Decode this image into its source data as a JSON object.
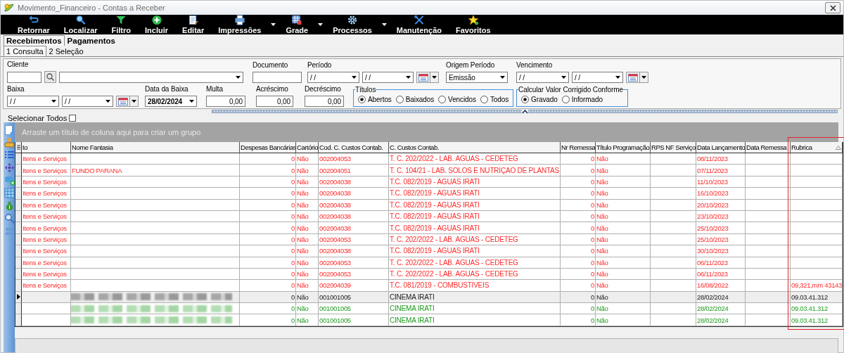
{
  "window": {
    "title": "Movimento_Financeiro - Contas a Receber"
  },
  "toolbar": [
    {
      "label": "Retornar",
      "dropdown": false
    },
    {
      "label": "Localizar",
      "dropdown": false
    },
    {
      "label": "Filtro",
      "dropdown": false
    },
    {
      "label": "Incluir",
      "dropdown": false
    },
    {
      "label": "Editar",
      "dropdown": false
    },
    {
      "label": "Impressões",
      "dropdown": true
    },
    {
      "label": "Grade",
      "dropdown": true
    },
    {
      "label": "Processos",
      "dropdown": true
    },
    {
      "label": "Manutenção",
      "dropdown": false
    },
    {
      "label": "Favoritos",
      "dropdown": false
    }
  ],
  "module_tabs": [
    {
      "label": "Recebimentos",
      "selected": true
    },
    {
      "label": "Pagamentos",
      "selected": false
    }
  ],
  "view_tabs": [
    {
      "label": "1 Consulta",
      "selected": true
    },
    {
      "label": "2 Seleção",
      "selected": false
    }
  ],
  "filters": [
    {
      "fields": [
        {
          "label": "Cliente",
          "controls": [
            {
              "kind": "input"
            },
            {
              "kind": "search"
            },
            {
              "kind": "combo"
            }
          ]
        },
        {
          "label": "Documento",
          "controls": [
            {
              "kind": "input"
            }
          ]
        },
        {
          "label": "Período",
          "controls": [
            {
              "kind": "combo",
              "value": "/ /"
            },
            {
              "kind": "combo",
              "value": "/ /"
            },
            {
              "kind": "calendar"
            }
          ]
        },
        {
          "label": "Origem Período",
          "controls": [
            {
              "kind": "combo",
              "value": "Emissão"
            }
          ]
        },
        {
          "label": "Vencimento",
          "controls": [
            {
              "kind": "combo",
              "value": "/ /"
            },
            {
              "kind": "combo",
              "value": "/ /"
            },
            {
              "kind": "calendar"
            }
          ]
        }
      ]
    },
    {
      "fields": [
        {
          "label": "Baixa",
          "controls": [
            {
              "kind": "combo",
              "value": "/ /"
            },
            {
              "kind": "combo",
              "value": "/ /"
            },
            {
              "kind": "calendar"
            }
          ]
        },
        {
          "label": "Data da Baixa",
          "controls": [
            {
              "kind": "combo",
              "value": "28/02/2024",
              "bold": true
            }
          ]
        },
        {
          "label": "Multa",
          "controls": [
            {
              "kind": "number",
              "value": "0,00"
            }
          ]
        },
        {
          "label": "Acréscimo",
          "controls": [
            {
              "kind": "number",
              "value": "0,00"
            }
          ]
        },
        {
          "label": "Decréscimo",
          "controls": [
            {
              "kind": "number",
              "value": "0,00"
            }
          ]
        },
        {
          "label": "Títulos",
          "kind": "radios",
          "options": [
            {
              "label": "Abertos",
              "selected": true
            },
            {
              "label": "Baixados",
              "selected": false
            },
            {
              "label": "Vencidos",
              "selected": false
            },
            {
              "label": "Todos",
              "selected": false
            }
          ]
        },
        {
          "label": "Calcular Valor Corrigido Conforme",
          "kind": "radios",
          "options": [
            {
              "label": "Gravado",
              "selected": true
            },
            {
              "label": "Informado",
              "selected": false
            }
          ]
        }
      ]
    }
  ],
  "select_all": {
    "label": "Selecionar Todos",
    "checked": false
  },
  "grid": {
    "group_hint": "Arraste um título de coluna aqui para criar um grupo",
    "columns": [
      {
        "label": "to"
      },
      {
        "label": "Nome Fantasia"
      },
      {
        "label": "Despesas Bancárias"
      },
      {
        "label": "Cartório"
      },
      {
        "label": "Cod. C. Custos Contab."
      },
      {
        "label": "C. Custos Contab."
      },
      {
        "label": "Nr Remessa"
      },
      {
        "label": "Título Programação"
      },
      {
        "label": "RPS NF Serviço"
      },
      {
        "label": "Data Lançamento"
      },
      {
        "label": "Data Remessa"
      },
      {
        "label": "Rubrica",
        "sorted": true,
        "highlighted": true
      }
    ],
    "rows": [
      {
        "color": "#ff2a2a",
        "selected": false,
        "cells": [
          "Itens e Serviços",
          null,
          "0",
          "Não",
          "002004053",
          "T. C. 202/2022 - LAB. AGUAS - CEDETEG",
          "0",
          "Não",
          null,
          "08/11/2023",
          null,
          null
        ]
      },
      {
        "color": "#ff2a2a",
        "selected": false,
        "cells": [
          "Itens e Serviços",
          "FUNDO PARANA",
          "0",
          "Não",
          "002004051",
          "T. C. 104/21 - LAB. SOLOS E NUTRIÇAO DE PLANTAS",
          "0",
          "Não",
          null,
          "07/11/2023",
          null,
          null
        ]
      },
      {
        "color": "#ff2a2a",
        "selected": false,
        "cells": [
          "Itens e Serviços",
          null,
          "0",
          "Não",
          "002004038",
          "T.C. 082/2019 - AGUAS IRATI",
          "0",
          "Não",
          null,
          "11/10/2023",
          null,
          null
        ]
      },
      {
        "color": "#ff2a2a",
        "selected": false,
        "cells": [
          "Itens e Serviços",
          null,
          "0",
          "Não",
          "002004038",
          "T.C. 082/2019 - AGUAS IRATI",
          "0",
          "Não",
          null,
          "16/10/2023",
          null,
          null
        ]
      },
      {
        "color": "#ff2a2a",
        "selected": false,
        "cells": [
          "Itens e Serviços",
          null,
          "0",
          "Não",
          "002004038",
          "T.C. 082/2019 - AGUAS IRATI",
          "0",
          "Não",
          null,
          "20/10/2023",
          null,
          null
        ]
      },
      {
        "color": "#ff2a2a",
        "selected": false,
        "cells": [
          "Itens e Serviços",
          null,
          "0",
          "Não",
          "002004038",
          "T.C. 082/2019 - AGUAS IRATI",
          "0",
          "Não",
          null,
          "23/10/2023",
          null,
          null
        ]
      },
      {
        "color": "#ff2a2a",
        "selected": false,
        "cells": [
          "Itens e Serviços",
          null,
          "0",
          "Não",
          "002004038",
          "T.C. 082/2019 - AGUAS IRATI",
          "0",
          "Não",
          null,
          "25/10/2023",
          null,
          null
        ]
      },
      {
        "color": "#ff2a2a",
        "selected": false,
        "cells": [
          "Itens e Serviços",
          null,
          "0",
          "Não",
          "002004053",
          "T. C. 202/2022 - LAB. AGUAS - CEDETEG",
          "0",
          "Não",
          null,
          "25/10/2023",
          null,
          null
        ]
      },
      {
        "color": "#ff2a2a",
        "selected": false,
        "cells": [
          "Itens e Serviços",
          null,
          "0",
          "Não",
          "002004038",
          "T.C. 082/2019 - AGUAS IRATI",
          "0",
          "Não",
          null,
          "30/10/2023",
          null,
          null
        ]
      },
      {
        "color": "#ff2a2a",
        "selected": false,
        "cells": [
          "Itens e Serviços",
          null,
          "0",
          "Não",
          "002004053",
          "T. C. 202/2022 - LAB. AGUAS - CEDETEG",
          "0",
          "Não",
          null,
          "06/11/2023",
          null,
          null
        ]
      },
      {
        "color": "#ff2a2a",
        "selected": false,
        "cells": [
          "Itens e Serviços",
          null,
          "0",
          "Não",
          "002004053",
          "T. C. 202/2022 - LAB. AGUAS - CEDETEG",
          "0",
          "Não",
          null,
          "06/11/2023",
          null,
          null
        ]
      },
      {
        "color": "#ff2a2a",
        "selected": false,
        "cells": [
          "Itens e Serviços",
          null,
          "0",
          "Não",
          "002004039",
          "T.C. 081/2019 - COMBUSTIVEIS",
          "0",
          "Não",
          null,
          "16/08/2022",
          null,
          "09,321,mm 43143"
        ]
      },
      {
        "color": "#1a1a1a",
        "selected": true,
        "name_blurred": true,
        "cells": [
          null,
          null,
          "0",
          "Não",
          "001001005",
          "CINEMA IRATI",
          "0",
          "Não",
          null,
          "28/02/2024",
          null,
          "09.03.41.312"
        ]
      },
      {
        "color": "#1f9a1f",
        "selected": false,
        "name_blurred": true,
        "cells": [
          null,
          null,
          "0",
          "Não",
          "001001005",
          "CINEMA IRATI",
          "0",
          "Não",
          null,
          "28/02/2024",
          null,
          "09.03.41.312"
        ]
      },
      {
        "color": "#1f9a1f",
        "selected": false,
        "name_blurred": true,
        "cells": [
          null,
          null,
          "0",
          "Não",
          "001001005",
          "CINEMA IRATI",
          "0",
          "Não",
          null,
          "28/02/2024",
          null,
          "09.03.41.312"
        ]
      }
    ]
  }
}
